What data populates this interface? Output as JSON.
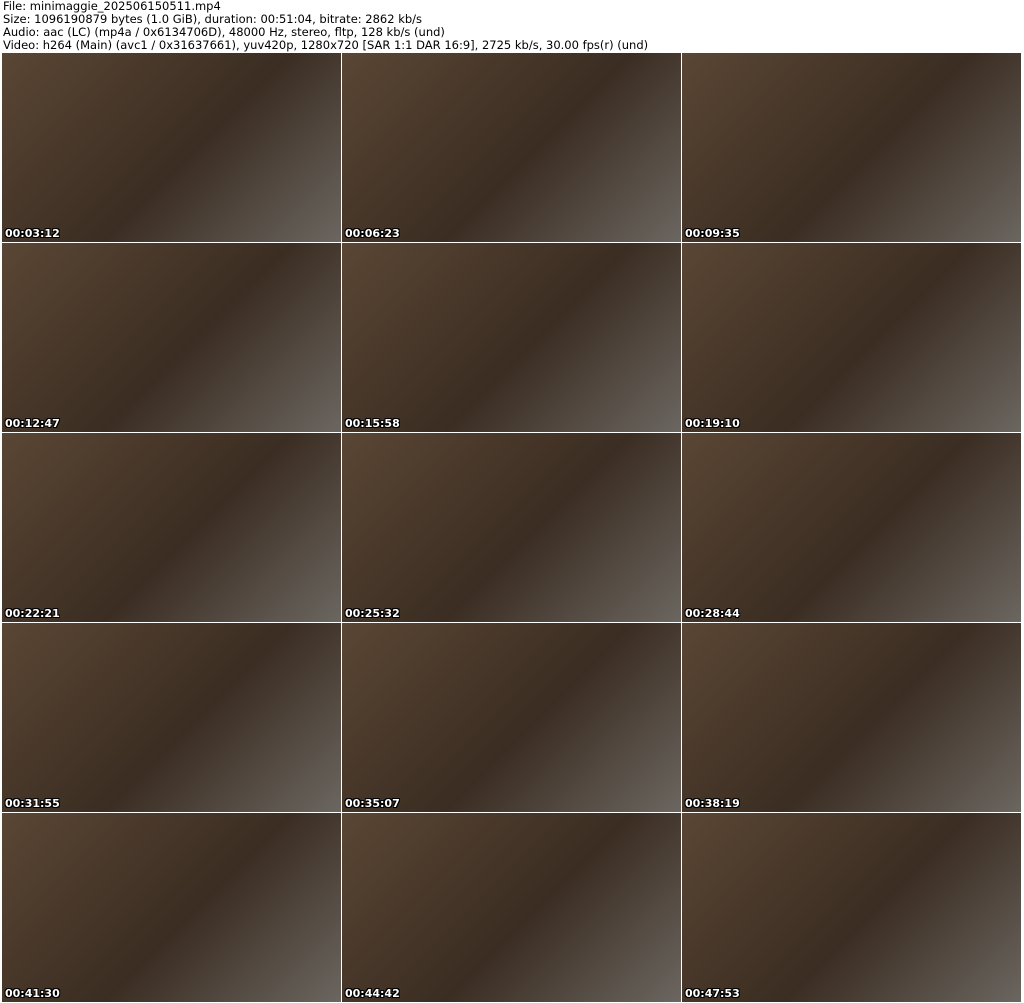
{
  "header": {
    "file": "File: minimaggie_202506150511.mp4",
    "size": "Size: 1096190879 bytes (1.0 GiB), duration: 00:51:04, bitrate: 2862 kb/s",
    "audio": "Audio: aac (LC) (mp4a / 0x6134706D), 48000 Hz, stereo, fltp, 128 kb/s (und)",
    "video": "Video: h264 (Main) (avc1 / 0x31637661), yuv420p, 1280x720 [SAR 1:1 DAR 16:9], 2725 kb/s, 30.00 fps(r) (und)"
  },
  "thumbnails": [
    {
      "timestamp": "00:03:12"
    },
    {
      "timestamp": "00:06:23"
    },
    {
      "timestamp": "00:09:35"
    },
    {
      "timestamp": "00:12:47"
    },
    {
      "timestamp": "00:15:58"
    },
    {
      "timestamp": "00:19:10"
    },
    {
      "timestamp": "00:22:21"
    },
    {
      "timestamp": "00:25:32"
    },
    {
      "timestamp": "00:28:44"
    },
    {
      "timestamp": "00:31:55"
    },
    {
      "timestamp": "00:35:07"
    },
    {
      "timestamp": "00:38:19"
    },
    {
      "timestamp": "00:41:30"
    },
    {
      "timestamp": "00:44:42"
    },
    {
      "timestamp": "00:47:53"
    }
  ]
}
